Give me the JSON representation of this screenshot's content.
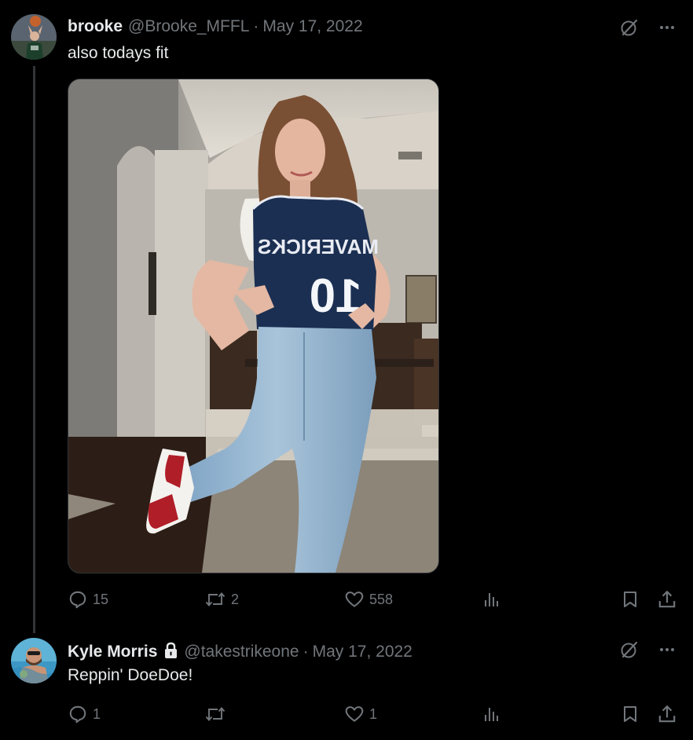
{
  "posts": [
    {
      "author": {
        "display_name": "brooke",
        "handle": "@Brooke_MFFL",
        "verified_lock": false
      },
      "separator": "·",
      "date": "May 17, 2022",
      "text": "also todays fit",
      "has_media": true,
      "media_content": {
        "jersey_text": "MAVERICKS",
        "jersey_number": "10"
      },
      "actions": {
        "replies": "15",
        "reposts": "2",
        "likes": "558",
        "views": ""
      },
      "icons": [
        "grok-icon",
        "more-icon",
        "reply-icon",
        "repost-icon",
        "like-icon",
        "views-icon",
        "bookmark-icon",
        "share-icon"
      ]
    },
    {
      "author": {
        "display_name": "Kyle Morris",
        "handle": "@takestrikeone",
        "verified_lock": true
      },
      "separator": "·",
      "date": "May 17, 2022",
      "text": "Reppin' DoeDoe!",
      "has_media": false,
      "actions": {
        "replies": "1",
        "reposts": "",
        "likes": "1",
        "views": ""
      },
      "icons": [
        "grok-icon",
        "more-icon",
        "reply-icon",
        "repost-icon",
        "like-icon",
        "views-icon",
        "bookmark-icon",
        "share-icon"
      ]
    }
  ],
  "colors": {
    "background": "#000000",
    "primary_text": "#e7e9ea",
    "secondary_text": "#71767b",
    "thread_line": "#333639"
  }
}
